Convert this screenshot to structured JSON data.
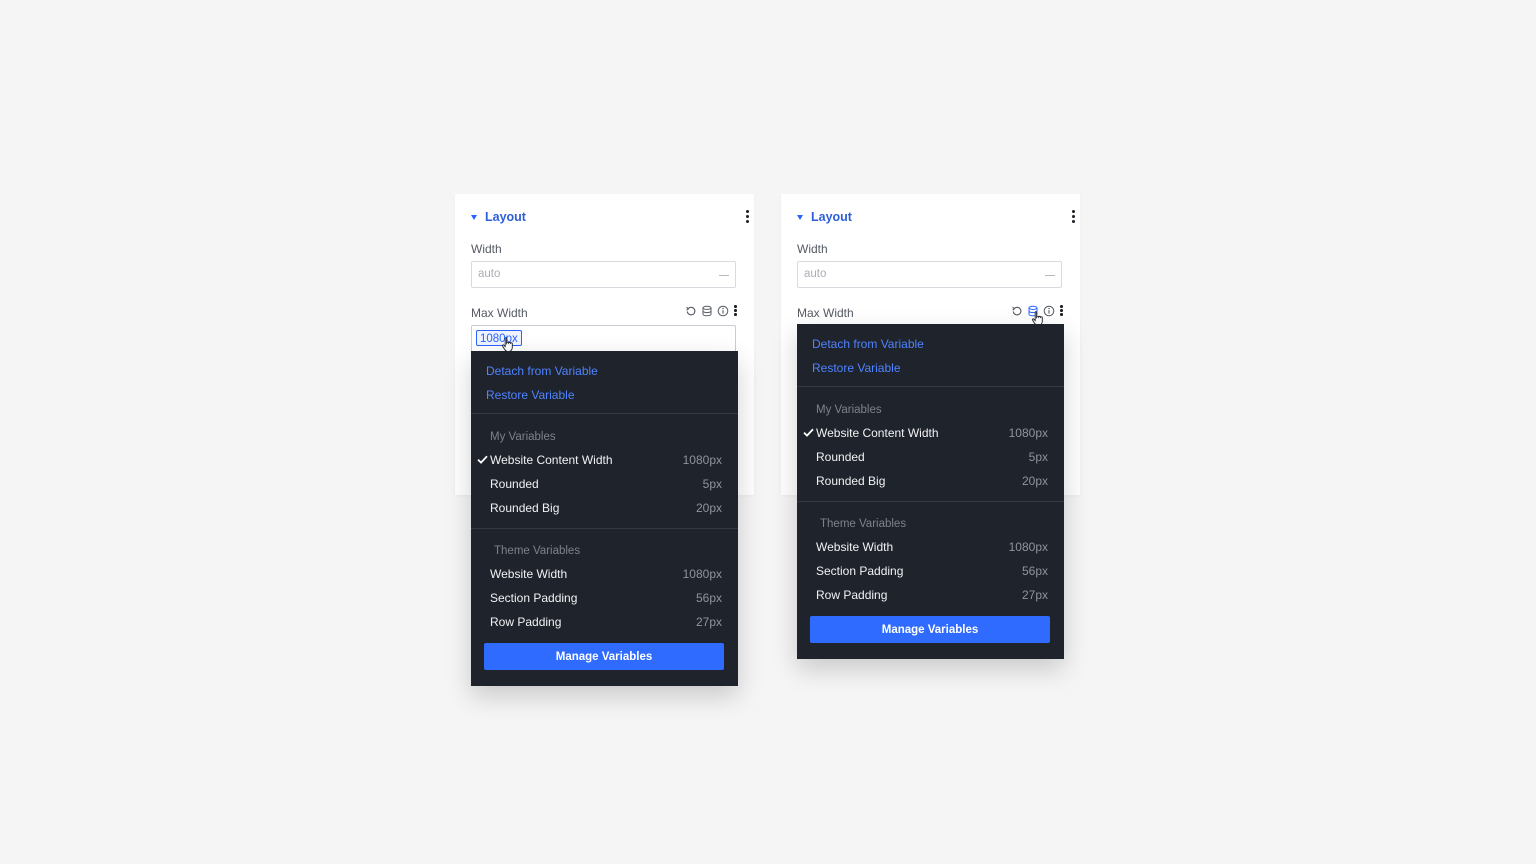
{
  "colors": {
    "accent": "#2962ff",
    "dropdown_bg": "#1f232b",
    "page_bg": "#f5f5f6"
  },
  "panels": [
    {
      "section_title": "Layout",
      "width_label": "Width",
      "width_value": "auto",
      "max_width_label": "Max Width",
      "max_width_value": "1080px",
      "dropdown": {
        "actions": [
          "Detach from Variable",
          "Restore Variable"
        ],
        "group1": "My Variables",
        "my_variables": [
          {
            "name": "Website Content Width",
            "value": "1080px",
            "selected": true
          },
          {
            "name": "Rounded",
            "value": "5px",
            "selected": false
          },
          {
            "name": "Rounded Big",
            "value": "20px",
            "selected": false
          }
        ],
        "group2": "Theme Variables",
        "theme_variables": [
          {
            "name": "Website Width",
            "value": "1080px"
          },
          {
            "name": "Section Padding",
            "value": "56px"
          },
          {
            "name": "Row Padding",
            "value": "27px"
          }
        ],
        "manage_label": "Manage Variables"
      }
    },
    {
      "section_title": "Layout",
      "width_label": "Width",
      "width_value": "auto",
      "max_width_label": "Max Width",
      "dropdown": {
        "actions": [
          "Detach from Variable",
          "Restore Variable"
        ],
        "group1": "My Variables",
        "my_variables": [
          {
            "name": "Website Content Width",
            "value": "1080px",
            "selected": true
          },
          {
            "name": "Rounded",
            "value": "5px",
            "selected": false
          },
          {
            "name": "Rounded Big",
            "value": "20px",
            "selected": false
          }
        ],
        "group2": "Theme Variables",
        "theme_variables": [
          {
            "name": "Website Width",
            "value": "1080px"
          },
          {
            "name": "Section Padding",
            "value": "56px"
          },
          {
            "name": "Row Padding",
            "value": "27px"
          }
        ],
        "manage_label": "Manage Variables"
      }
    }
  ]
}
